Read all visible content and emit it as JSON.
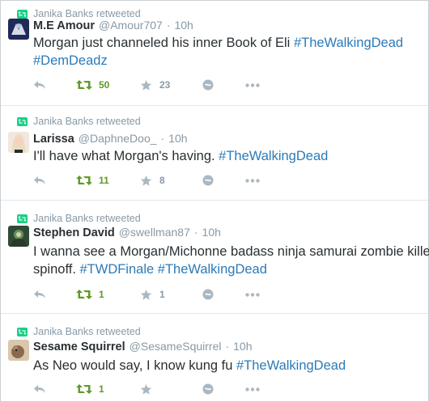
{
  "tweets": [
    {
      "retweeted_by": "Janika Banks retweeted",
      "fullname": "M.E Amour",
      "handle": "@Amour707",
      "dot": "·",
      "time": "10h",
      "line1": [
        {
          "t": "Morgan just channeled his inner Book of Eli ",
          "h": false
        },
        {
          "t": "#TheWalkingDead",
          "h": true
        }
      ],
      "line2": [
        {
          "t": "#DemDeadz",
          "h": true
        }
      ],
      "retweets": "50",
      "favorites": "23",
      "avatar_color": "#1f2a5a"
    },
    {
      "retweeted_by": "Janika Banks retweeted",
      "fullname": "Larissa",
      "handle": "@DaphneDoo_",
      "dot": "·",
      "time": "10h",
      "line1": [
        {
          "t": "I'll have what Morgan's having. ",
          "h": false
        },
        {
          "t": "#TheWalkingDead",
          "h": true
        }
      ],
      "line2": [],
      "retweets": "11",
      "favorites": "8",
      "avatar_color": "#e8d2c8"
    },
    {
      "retweeted_by": "Janika Banks retweeted",
      "fullname": "Stephen David",
      "handle": "@swellman87",
      "dot": "·",
      "time": "10h",
      "line1": [
        {
          "t": "I wanna see a Morgan/Michonne badass ninja samurai zombie killer",
          "h": false
        }
      ],
      "line2": [
        {
          "t": "spinoff. ",
          "h": false
        },
        {
          "t": "#TWDFinale",
          "h": true
        },
        {
          "t": " ",
          "h": false
        },
        {
          "t": "#TheWalkingDead",
          "h": true
        }
      ],
      "retweets": "1",
      "favorites": "1",
      "avatar_color": "#3d5a3a"
    },
    {
      "retweeted_by": "Janika Banks retweeted",
      "fullname": "Sesame Squirrel",
      "handle": "@SesameSquirrel",
      "dot": "·",
      "time": "10h",
      "line1": [
        {
          "t": "As Neo would say, I know kung fu ",
          "h": false
        },
        {
          "t": "#TheWalkingDead",
          "h": true
        }
      ],
      "line2": [],
      "retweets": "1",
      "favorites": "",
      "avatar_color": "#8a6a4a"
    }
  ],
  "colors": {
    "retweet_green": "#609928",
    "hashtag_blue": "#2b7bb9",
    "muted_gray": "#8899a6",
    "icon_gray": "#aab8c2"
  }
}
